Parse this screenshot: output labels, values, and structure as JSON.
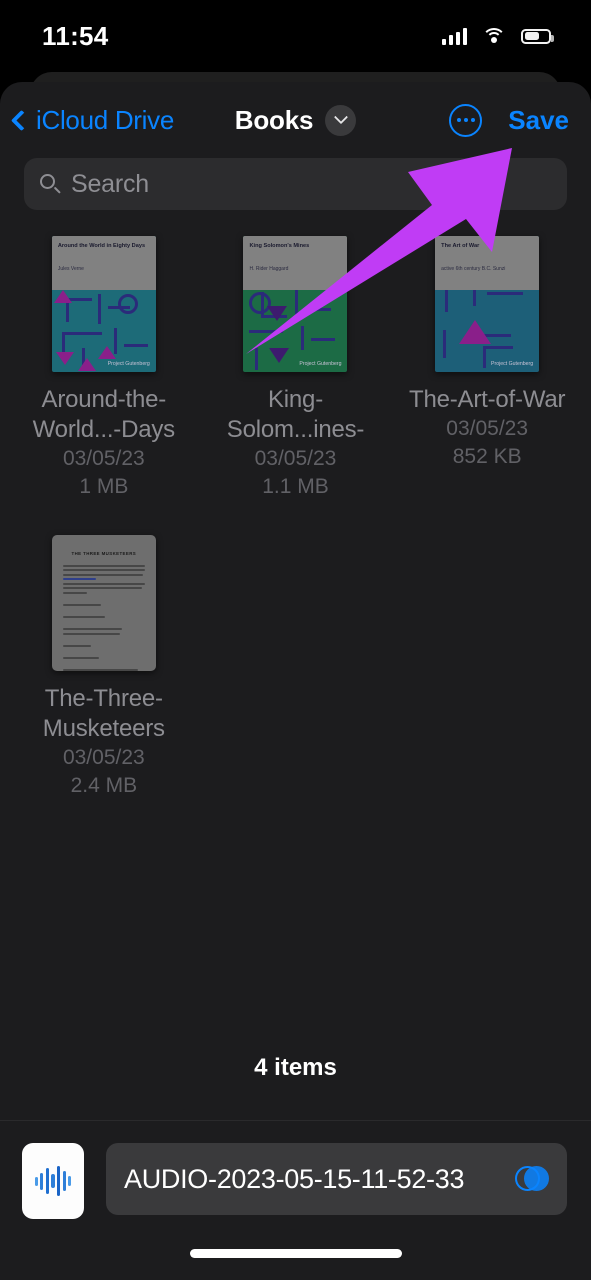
{
  "status_bar": {
    "time": "11:54",
    "cellular_icon": "signal-bars-icon",
    "wifi_icon": "wifi-icon",
    "battery_icon": "battery-icon"
  },
  "navigation": {
    "back_label": "iCloud Drive",
    "back_icon": "chevron-left-icon",
    "title": "Books",
    "title_dropdown_icon": "chevron-down-icon",
    "more_icon": "ellipsis-circle-icon",
    "save_label": "Save"
  },
  "search": {
    "placeholder": "Search",
    "value": "",
    "icon": "search-icon"
  },
  "files": [
    {
      "name": "Around-the-World...-Days",
      "date": "03/05/23",
      "size": "1 MB",
      "thumbnail": {
        "kind": "book-cover",
        "title": "Around the World in Eighty Days",
        "author": "Jules Verne",
        "publisher": "Project Gutenberg",
        "cover_color": "#1d6b78",
        "header_color": "#818181",
        "accent_color": "#8a1f8a"
      }
    },
    {
      "name": "King-Solom...ines-",
      "date": "03/05/23",
      "size": "1.1 MB",
      "thumbnail": {
        "kind": "book-cover",
        "title": "King Solomon's Mines",
        "author": "H. Rider Haggard",
        "publisher": "Project Gutenberg",
        "cover_color": "#1c6b45",
        "header_color": "#818181",
        "accent_color": "#3d1b6e"
      }
    },
    {
      "name": "The-Art-of-War",
      "date": "03/05/23",
      "size": "852 KB",
      "thumbnail": {
        "kind": "book-cover",
        "title": "The Art of War",
        "author": "active 6th century B.C. Sunzi",
        "publisher": "Project Gutenberg",
        "cover_color": "#1d5f78",
        "header_color": "#818181",
        "accent_color": "#8a1f8a"
      }
    },
    {
      "name": "The-Three-Musketeers",
      "date": "03/05/23",
      "size": "2.4 MB",
      "thumbnail": {
        "kind": "text-document",
        "title": "THE THREE MUSKETEERS",
        "page_color": "#6e6e6e"
      }
    }
  ],
  "footer": {
    "item_count_label": "4 items"
  },
  "save_bar": {
    "file_icon": "audio-waveform-icon",
    "file_name": "AUDIO-2023-05-15-11-52-33",
    "options_icon": "dual-circle-icon"
  },
  "annotation": {
    "arrow_icon": "pointer-arrow-annotation",
    "color": "#c03cf5",
    "points_to": "Save"
  },
  "theme": {
    "background": "#000000",
    "sheet_background": "#1c1c1e",
    "accent_blue": "#0a84ff",
    "field_background": "#2c2c2e",
    "secondary_text": "#8e8e93"
  }
}
